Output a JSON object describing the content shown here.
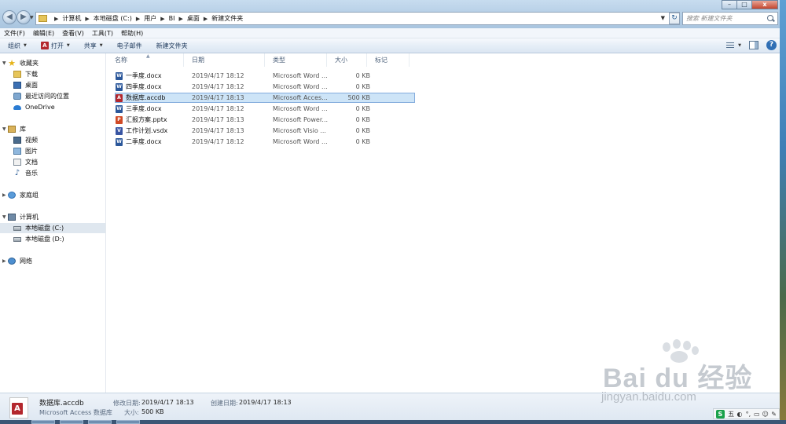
{
  "address": {
    "crumbs": [
      "计算机",
      "本地磁盘 (C:)",
      "用户",
      "BI",
      "桌面",
      "新建文件夹"
    ]
  },
  "search": {
    "placeholder": "搜索 新建文件夹"
  },
  "menu": [
    "文件(F)",
    "编辑(E)",
    "查看(V)",
    "工具(T)",
    "帮助(H)"
  ],
  "toolbar": {
    "organize": "组织",
    "open": "打开",
    "share": "共享",
    "email": "电子邮件",
    "new_folder": "新建文件夹"
  },
  "nav": {
    "favorites": "收藏夹",
    "downloads": "下载",
    "desktop": "桌面",
    "recent": "最近访问的位置",
    "onedrive": "OneDrive",
    "libraries": "库",
    "videos": "视频",
    "pictures": "图片",
    "documents": "文档",
    "music": "音乐",
    "homegroup": "家庭组",
    "computer": "计算机",
    "drive_c": "本地磁盘 (C:)",
    "drive_d": "本地磁盘 (D:)",
    "network": "网络"
  },
  "columns": [
    "名称",
    "日期",
    "类型",
    "大小",
    "标记"
  ],
  "files": [
    {
      "name": "一季度.docx",
      "date": "2019/4/17 18:12",
      "type": "Microsoft Word ...",
      "size": "0 KB",
      "icon": "word"
    },
    {
      "name": "四季度.docx",
      "date": "2019/4/17 18:12",
      "type": "Microsoft Word ...",
      "size": "0 KB",
      "icon": "word"
    },
    {
      "name": "数据库.accdb",
      "date": "2019/4/17 18:13",
      "type": "Microsoft Acces...",
      "size": "500 KB",
      "icon": "access"
    },
    {
      "name": "三季度.docx",
      "date": "2019/4/17 18:12",
      "type": "Microsoft Word ...",
      "size": "0 KB",
      "icon": "word"
    },
    {
      "name": "汇报方案.pptx",
      "date": "2019/4/17 18:13",
      "type": "Microsoft Power...",
      "size": "0 KB",
      "icon": "ppt"
    },
    {
      "name": "工作计划.vsdx",
      "date": "2019/4/17 18:13",
      "type": "Microsoft Visio ...",
      "size": "0 KB",
      "icon": "visio"
    },
    {
      "name": "二季度.docx",
      "date": "2019/4/17 18:12",
      "type": "Microsoft Word ...",
      "size": "0 KB",
      "icon": "word"
    }
  ],
  "details": {
    "name": "数据库.accdb",
    "type": "Microsoft Access 数据库",
    "modified_label": "修改日期:",
    "modified_value": "2019/4/17 18:13",
    "size_label": "大小:",
    "size_value": "500 KB",
    "created_label": "创建日期:",
    "created_value": "2019/4/17 18:13"
  },
  "watermark": {
    "brand": "Bai du 经验",
    "url": "jingyan.baidu.com"
  },
  "ime": {
    "label": "五"
  },
  "window_controls": {
    "minimize": "–",
    "maximize": "□",
    "close": "x"
  }
}
